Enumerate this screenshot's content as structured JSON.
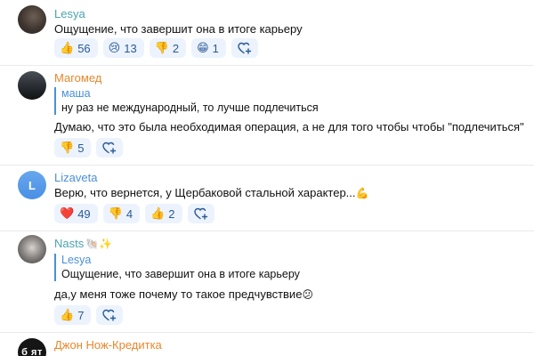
{
  "comments": [
    {
      "author": "Lesya",
      "text": "Ощущение, что завершит она в итоге карьеру",
      "reactions": [
        {
          "emoji": "👍",
          "count": "56"
        },
        {
          "emoji": "😢",
          "count": "13"
        },
        {
          "emoji": "👎",
          "count": "2"
        },
        {
          "emoji": "😁",
          "count": "1"
        }
      ]
    },
    {
      "author": "Магомед",
      "quote": {
        "author": "маша",
        "text": "ну раз не международный, то лучше подлечиться"
      },
      "text": "Думаю, что это была необходимая операция, а не для того чтобы чтобы \"подлечиться\"",
      "reactions": [
        {
          "emoji": "👎",
          "count": "5"
        }
      ]
    },
    {
      "author": "Lizaveta",
      "avatar_letter": "L",
      "text": "Верю, что вернется, у Щербаковой стальной характер...",
      "text_emoji": "💪",
      "reactions": [
        {
          "emoji": "❤️",
          "count": "49"
        },
        {
          "emoji": "👎",
          "count": "4"
        },
        {
          "emoji": "👍",
          "count": "2"
        }
      ]
    },
    {
      "author": "Nasts",
      "author_emoji": "🐚✨",
      "quote": {
        "author": "Lesya",
        "text": "Ощущение, что завершит она в итоге карьеру"
      },
      "text": "да,у меня тоже почему то такое предчувствие",
      "text_emoji": "😕",
      "reactions": [
        {
          "emoji": "👍",
          "count": "7"
        }
      ]
    },
    {
      "author": "Джон Нож-Кредитка",
      "avatar_text": "б ят"
    }
  ],
  "colors": {
    "reaction_bg": "#ecf3fd",
    "reaction_text": "#2b5a96",
    "quote_bar": "#4a90d9"
  },
  "icons": {
    "add_reaction": "heart-plus-icon"
  }
}
